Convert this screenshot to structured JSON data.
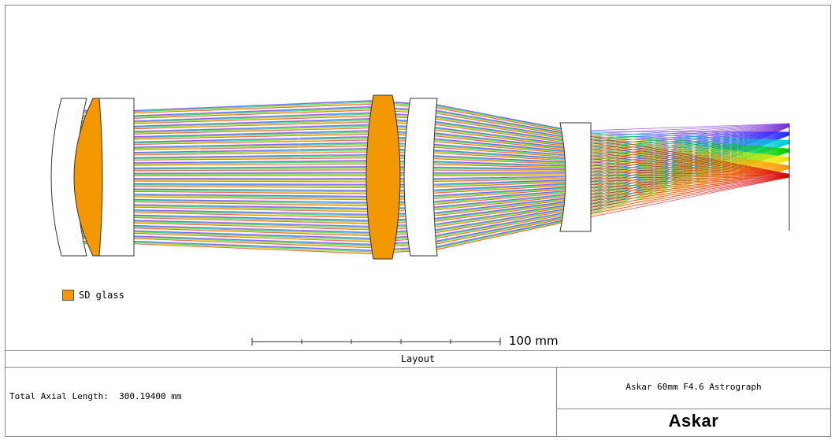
{
  "legend": {
    "label": "SD glass",
    "color": "#f39800"
  },
  "scale": {
    "label": "100 mm"
  },
  "panel": {
    "title": "Layout"
  },
  "info": {
    "total_axial_length": "Total Axial Length:  300.19400 mm",
    "design_name": "Askar 60mm F4.6 Astrograph",
    "brand": "Askar"
  },
  "ray_colors": [
    "#7b2fd6",
    "#2b2bff",
    "#00c8d8",
    "#00d000",
    "#e8e800",
    "#ff9900",
    "#d80000"
  ]
}
